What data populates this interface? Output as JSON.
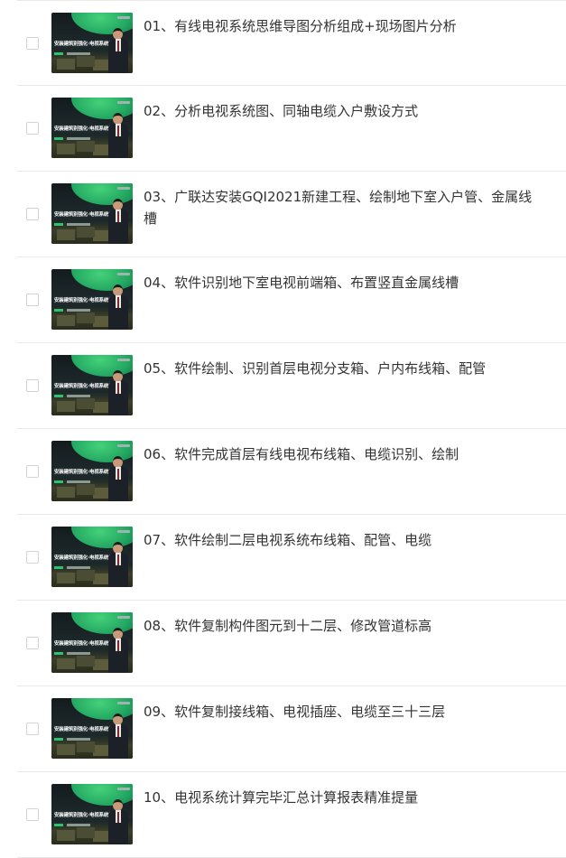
{
  "thumbnail": {
    "caption": "安装建筑别强化·电视系统篇"
  },
  "lessons": [
    {
      "title": "01、有线电视系统思维导图分析组成+现场图片分析"
    },
    {
      "title": "02、分析电视系统图、同轴电缆入户敷设方式"
    },
    {
      "title": "03、广联达安装GQI2021新建工程、绘制地下室入户管、金属线槽"
    },
    {
      "title": "04、软件识别地下室电视前端箱、布置竖直金属线槽"
    },
    {
      "title": "05、软件绘制、识别首层电视分支箱、户内布线箱、配管"
    },
    {
      "title": "06、软件完成首层有线电视布线箱、电缆识别、绘制"
    },
    {
      "title": "07、软件绘制二层电视系统布线箱、配管、电缆"
    },
    {
      "title": "08、软件复制构件图元到十二层、修改管道标高"
    },
    {
      "title": "09、软件复制接线箱、电视插座、电缆至三十三层"
    },
    {
      "title": "10、电视系统计算完毕汇总计算报表精准提量"
    }
  ]
}
